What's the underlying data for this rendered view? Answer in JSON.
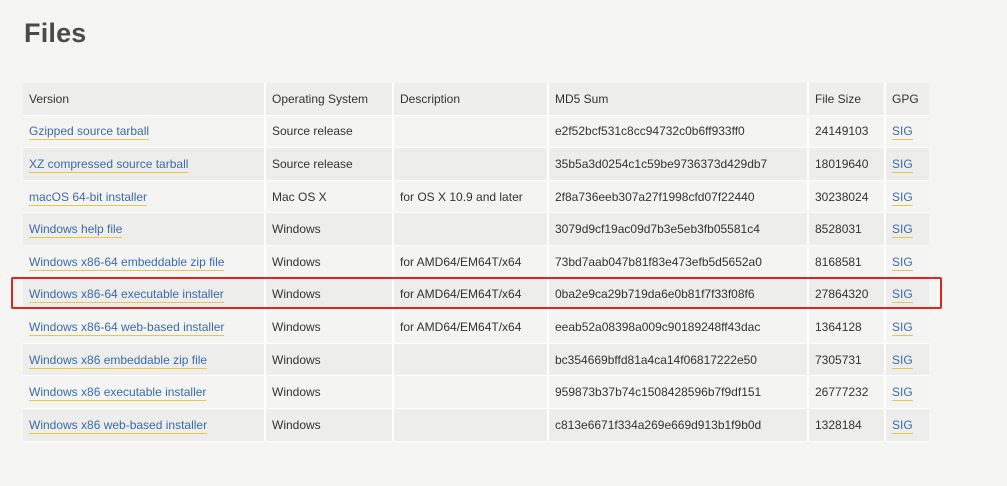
{
  "page": {
    "title": "Files"
  },
  "table": {
    "headers": {
      "version": "Version",
      "os": "Operating System",
      "description": "Description",
      "md5": "MD5 Sum",
      "size": "File Size",
      "gpg": "GPG"
    },
    "rows": [
      {
        "version": "Gzipped source tarball",
        "os": "Source release",
        "description": "",
        "md5": "e2f52bcf531c8cc94732c0b6ff933ff0",
        "size": "24149103",
        "gpg": "SIG"
      },
      {
        "version": "XZ compressed source tarball",
        "os": "Source release",
        "description": "",
        "md5": "35b5a3d0254c1c59be9736373d429db7",
        "size": "18019640",
        "gpg": "SIG"
      },
      {
        "version": "macOS 64-bit installer",
        "os": "Mac OS X",
        "description": "for OS X 10.9 and later",
        "md5": "2f8a736eeb307a27f1998cfd07f22440",
        "size": "30238024",
        "gpg": "SIG"
      },
      {
        "version": "Windows help file",
        "os": "Windows",
        "description": "",
        "md5": "3079d9cf19ac09d7b3e5eb3fb05581c4",
        "size": "8528031",
        "gpg": "SIG"
      },
      {
        "version": "Windows x86-64 embeddable zip file",
        "os": "Windows",
        "description": "for AMD64/EM64T/x64",
        "md5": "73bd7aab047b81f83e473efb5d5652a0",
        "size": "8168581",
        "gpg": "SIG"
      },
      {
        "version": "Windows x86-64 executable installer",
        "os": "Windows",
        "description": "for AMD64/EM64T/x64",
        "md5": "0ba2e9ca29b719da6e0b81f7f33f08f6",
        "size": "27864320",
        "gpg": "SIG"
      },
      {
        "version": "Windows x86-64 web-based installer",
        "os": "Windows",
        "description": "for AMD64/EM64T/x64",
        "md5": "eeab52a08398a009c90189248ff43dac",
        "size": "1364128",
        "gpg": "SIG"
      },
      {
        "version": "Windows x86 embeddable zip file",
        "os": "Windows",
        "description": "",
        "md5": "bc354669bffd81a4ca14f06817222e50",
        "size": "7305731",
        "gpg": "SIG"
      },
      {
        "version": "Windows x86 executable installer",
        "os": "Windows",
        "description": "",
        "md5": "959873b37b74c1508428596b7f9df151",
        "size": "26777232",
        "gpg": "SIG"
      },
      {
        "version": "Windows x86 web-based installer",
        "os": "Windows",
        "description": "",
        "md5": "c813e6671f334a269e669d913b1f9b0d",
        "size": "1328184",
        "gpg": "SIG"
      }
    ]
  },
  "colors": {
    "link": "#3b6ba5",
    "link_underline": "#e8c64c",
    "highlight_box": "#e02424",
    "title": "#4a4a4a"
  }
}
